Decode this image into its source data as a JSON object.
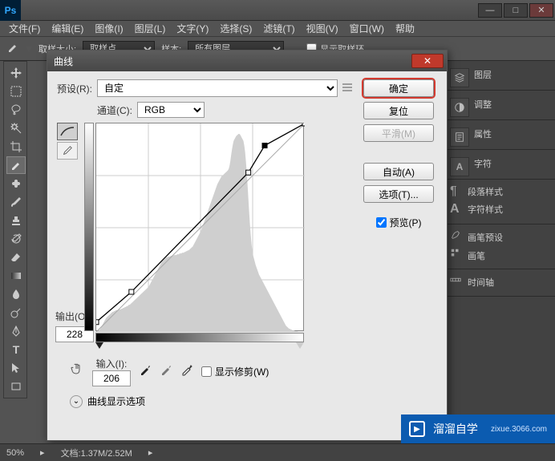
{
  "app": {
    "logo": "Ps"
  },
  "menus": [
    "文件(F)",
    "编辑(E)",
    "图像(I)",
    "图层(L)",
    "文字(Y)",
    "选择(S)",
    "滤镜(T)",
    "视图(V)",
    "窗口(W)",
    "帮助"
  ],
  "optbar": {
    "sample_size_label": "取样大小:",
    "sample_size_value": "取样点",
    "sample_label": "样本:",
    "sample_value": "所有图层",
    "show_ring": "显示取样环"
  },
  "panels": {
    "layers": "图层",
    "adjust": "调整",
    "props": "属性",
    "char": "字符",
    "parastyle": "段落样式",
    "charstyle": "字符样式",
    "brushpreset": "画笔预设",
    "brush": "画笔",
    "timeline": "时间轴"
  },
  "status": {
    "zoom": "50%",
    "doc": "文档:1.37M/2.52M"
  },
  "dialog": {
    "title": "曲线",
    "preset_label": "预设(R):",
    "preset_value": "自定",
    "channel_label": "通道(C):",
    "channel_value": "RGB",
    "output_label": "输出(O):",
    "output_value": "228",
    "input_label": "输入(I):",
    "input_value": "206",
    "show_clipping": "显示修剪(W)",
    "disclose": "曲线显示选项",
    "ok": "确定",
    "reset": "复位",
    "smooth": "平滑(M)",
    "auto": "自动(A)",
    "options": "选项(T)...",
    "preview": "预览(P)"
  },
  "chart_data": {
    "type": "line",
    "title": "曲线",
    "xlabel": "输入",
    "ylabel": "输出",
    "xlim": [
      0,
      255
    ],
    "ylim": [
      0,
      255
    ],
    "control_points": [
      {
        "x": 0,
        "y": 12
      },
      {
        "x": 43,
        "y": 49
      },
      {
        "x": 186,
        "y": 195
      },
      {
        "x": 206,
        "y": 228
      },
      {
        "x": 255,
        "y": 255
      }
    ],
    "baseline": [
      {
        "x": 0,
        "y": 0
      },
      {
        "x": 255,
        "y": 255
      }
    ],
    "histogram": [
      0,
      0,
      1,
      2,
      3,
      4,
      6,
      8,
      10,
      12,
      14,
      16,
      18,
      19,
      20,
      21,
      22,
      23,
      24,
      25,
      26,
      26,
      27,
      27,
      28,
      28,
      28,
      28,
      29,
      29,
      29,
      30,
      30,
      31,
      31,
      32,
      32,
      33,
      33,
      34,
      35,
      35,
      36,
      37,
      38,
      39,
      40,
      41,
      42,
      43,
      44,
      45,
      46,
      47,
      48,
      49,
      50,
      51,
      52,
      53,
      54,
      55,
      56,
      57,
      58,
      60,
      62,
      64,
      66,
      68,
      70,
      72,
      74,
      76,
      78,
      80,
      82,
      84,
      86,
      88,
      90,
      91,
      92,
      93,
      94,
      95,
      96,
      96,
      97,
      97,
      97,
      98,
      98,
      98,
      98,
      99,
      99,
      99,
      99,
      100,
      100,
      100,
      101,
      101,
      101,
      102,
      102,
      102,
      103,
      103,
      104,
      104,
      105,
      105,
      106,
      107,
      108,
      109,
      110,
      112,
      114,
      116,
      118,
      120,
      122,
      124,
      126,
      128,
      130,
      133,
      136,
      139,
      142,
      145,
      148,
      151,
      154,
      157,
      160,
      163,
      166,
      169,
      172,
      175,
      178,
      181,
      184,
      187,
      190,
      192,
      194,
      196,
      198,
      200,
      201,
      202,
      203,
      204,
      205,
      206,
      207,
      208,
      210,
      214,
      220,
      228,
      235,
      241,
      246,
      248,
      250,
      252,
      253,
      254,
      255,
      255,
      254,
      252,
      250,
      248,
      246,
      240,
      232,
      220,
      206,
      190,
      172,
      154,
      138,
      124,
      112,
      104,
      98,
      94,
      90,
      86,
      83,
      80,
      77,
      74,
      72,
      70,
      68,
      66,
      64,
      62,
      60,
      58,
      56,
      54,
      52,
      50,
      48,
      46,
      44,
      42,
      40,
      38,
      36,
      34,
      32,
      30,
      28,
      26,
      24,
      22,
      20,
      18,
      16,
      14,
      12,
      10,
      8,
      7,
      6,
      5,
      4,
      4,
      3,
      3,
      2,
      2,
      2,
      1,
      1,
      1,
      1,
      0,
      0,
      0,
      0,
      0,
      0,
      0,
      0,
      0
    ]
  },
  "watermark": {
    "brand": "溜溜自学",
    "sub": "zixue",
    "domain": "3066.com"
  }
}
